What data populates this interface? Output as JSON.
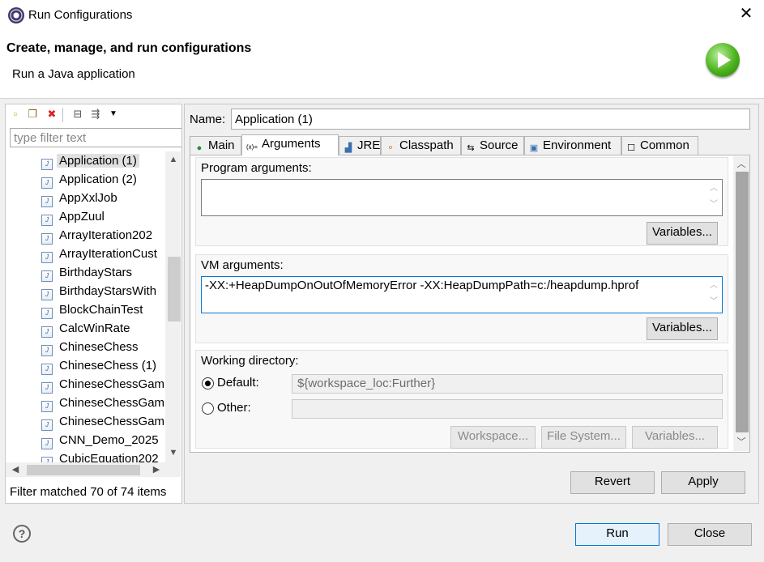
{
  "window": {
    "title": "Run Configurations",
    "close_glyph": "✕"
  },
  "header": {
    "title": "Create, manage, and run configurations",
    "subtitle": "Run a Java application",
    "badge_icon": "run-green-icon"
  },
  "left": {
    "toolbar_icons": [
      "new-config-icon",
      "duplicate-icon",
      "delete-icon",
      "collapse-all-icon",
      "filter-icon",
      "dropdown-arrow-icon"
    ],
    "filter_placeholder": "type filter text",
    "items": [
      "Application (1)",
      "Application (2)",
      "AppXxlJob",
      "AppZuul",
      "ArrayIteration202",
      "ArrayIterationCust",
      "BirthdayStars",
      "BirthdayStarsWith",
      "BlockChainTest",
      "CalcWinRate",
      "ChineseChess",
      "ChineseChess (1)",
      "ChineseChessGam",
      "ChineseChessGam",
      "ChineseChessGam",
      "CNN_Demo_2025",
      "CubicEquation202"
    ],
    "selected_index": 0,
    "status": "Filter matched 70 of 74 items"
  },
  "right": {
    "name_label": "Name:",
    "name_value": "Application (1)",
    "tabs": [
      {
        "label": "Main",
        "icon": "main-tab-icon",
        "glyph": "●"
      },
      {
        "label": "Arguments",
        "icon": "arguments-tab-icon",
        "glyph": "(x)="
      },
      {
        "label": "JRE",
        "icon": "jre-tab-icon",
        "glyph": "▟"
      },
      {
        "label": "Classpath",
        "icon": "classpath-tab-icon",
        "glyph": "⚬"
      },
      {
        "label": "Source",
        "icon": "source-tab-icon",
        "glyph": "⇆"
      },
      {
        "label": "Environment",
        "icon": "environment-tab-icon",
        "glyph": "▣"
      },
      {
        "label": "Common",
        "icon": "common-tab-icon",
        "glyph": "☐"
      }
    ],
    "active_tab": 1,
    "program_args": {
      "label": "Program arguments:",
      "value": "",
      "variables_label": "Variables..."
    },
    "vm_args": {
      "label": "VM arguments:",
      "value": "-XX:+HeapDumpOnOutOfMemoryError -XX:HeapDumpPath=c:/heapdump.hprof",
      "variables_label": "Variables..."
    },
    "working_dir": {
      "label": "Working directory:",
      "default_label": "Default:",
      "default_value": "${workspace_loc:Further}",
      "other_label": "Other:",
      "other_value": "",
      "workspace_label": "Workspace...",
      "filesystem_label": "File System...",
      "variables_label": "Variables..."
    },
    "revert_label": "Revert",
    "apply_label": "Apply"
  },
  "footer": {
    "help_glyph": "?",
    "run_label": "Run",
    "close_label": "Close"
  }
}
